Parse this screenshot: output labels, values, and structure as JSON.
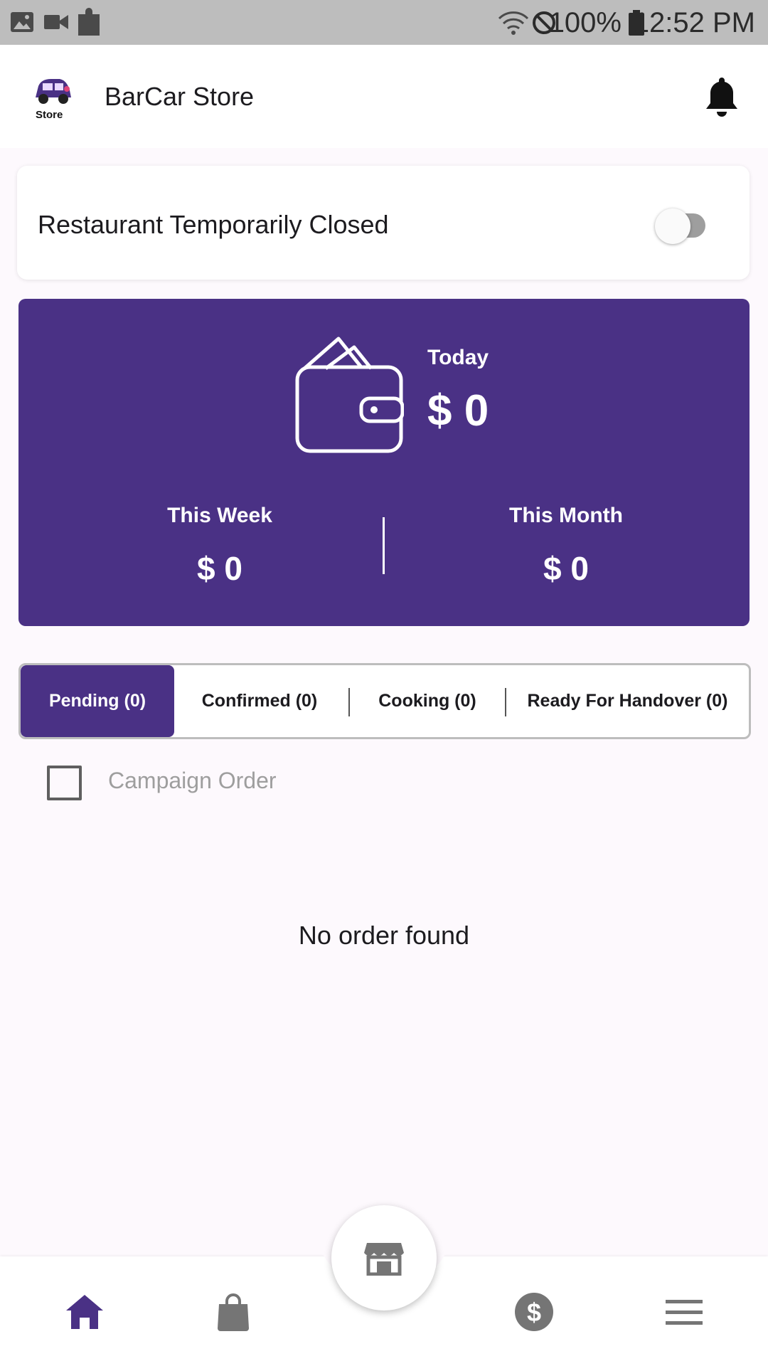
{
  "status_bar": {
    "battery_percent": "100%",
    "time": "12:52 PM",
    "icons": [
      "image-icon",
      "video-icon",
      "puzzle-icon",
      "wifi-icon",
      "do-not-disturb-icon",
      "battery-icon"
    ]
  },
  "app_bar": {
    "title": "BarCar Store",
    "logo_text": "Store",
    "notification_icon": "bell-icon"
  },
  "closed_toggle": {
    "label": "Restaurant Temporarily Closed",
    "on": false
  },
  "earnings": {
    "today_label": "Today",
    "today_value": "$ 0",
    "week_label": "This Week",
    "week_value": "$ 0",
    "month_label": "This Month",
    "month_value": "$ 0"
  },
  "tabs": [
    {
      "label": "Pending (0)",
      "active": true
    },
    {
      "label": "Confirmed (0)",
      "active": false
    },
    {
      "label": "Cooking (0)",
      "active": false
    },
    {
      "label": "Ready For Handover (0)",
      "active": false
    }
  ],
  "campaign": {
    "label": "Campaign Order",
    "checked": false
  },
  "empty_message": "No order found",
  "bottom_nav": {
    "items": [
      "home-icon",
      "shopping-bag-icon",
      "store-icon",
      "dollar-icon",
      "menu-icon"
    ],
    "active": "home-icon"
  },
  "colors": {
    "primary": "#4a3185",
    "inactive_icon": "#757575"
  }
}
